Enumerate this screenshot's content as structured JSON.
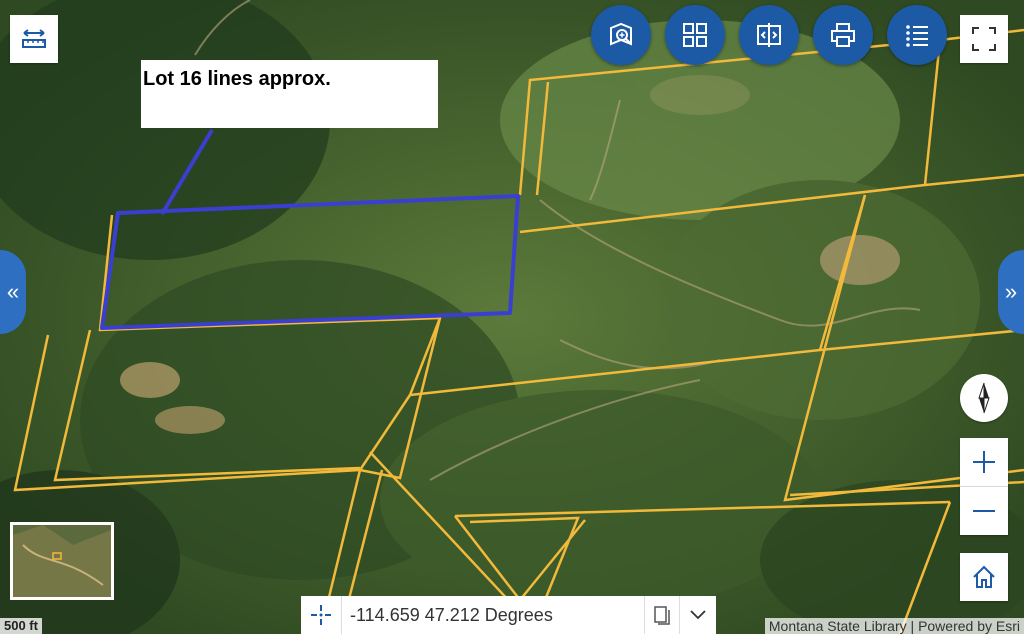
{
  "annotation": {
    "text": "Lot 16 lines approx."
  },
  "coordinates": {
    "text": "-114.659 47.212 Degrees"
  },
  "attribution": {
    "source": "Montana State Library",
    "powered_by": "Powered by Esri"
  },
  "scale_bar": {
    "label": "500 ft"
  },
  "toolbar": {
    "items": [
      "zoom-to-area-icon",
      "basemap-gallery-icon",
      "swipe-compare-icon",
      "print-icon",
      "legend-list-icon"
    ]
  },
  "colors": {
    "parcel_line": "#f2b93b",
    "lot_outline": "#3b3fd1",
    "button_blue": "#1d5aa6",
    "side_tab_blue": "#2f6fc2"
  }
}
